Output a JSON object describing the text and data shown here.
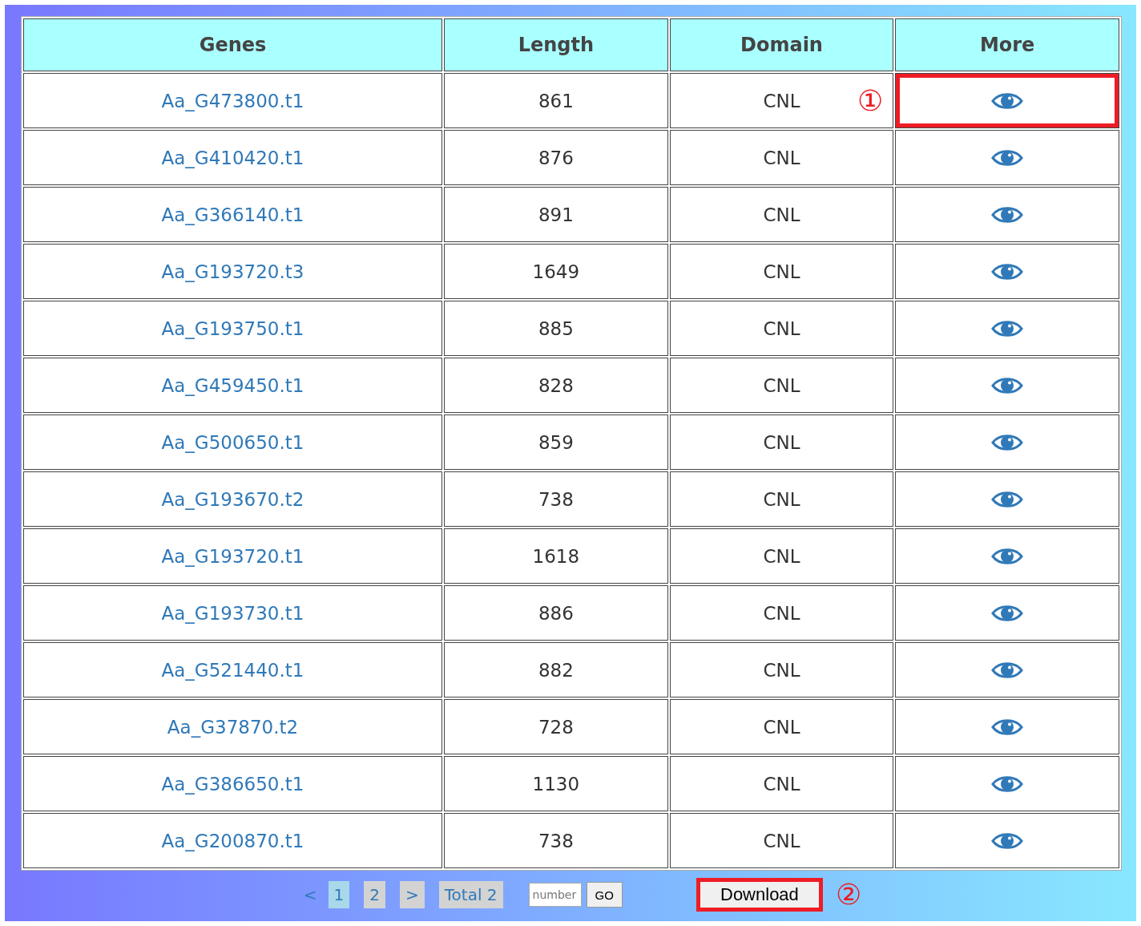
{
  "table": {
    "columns": [
      "Genes",
      "Length",
      "Domain",
      "More"
    ],
    "rows": [
      {
        "gene": "Aa_G473800.t1",
        "length": "861",
        "domain": "CNL",
        "highlighted": true,
        "callout": "①"
      },
      {
        "gene": "Aa_G410420.t1",
        "length": "876",
        "domain": "CNL",
        "highlighted": false
      },
      {
        "gene": "Aa_G366140.t1",
        "length": "891",
        "domain": "CNL",
        "highlighted": false
      },
      {
        "gene": "Aa_G193720.t3",
        "length": "1649",
        "domain": "CNL",
        "highlighted": false
      },
      {
        "gene": "Aa_G193750.t1",
        "length": "885",
        "domain": "CNL",
        "highlighted": false
      },
      {
        "gene": "Aa_G459450.t1",
        "length": "828",
        "domain": "CNL",
        "highlighted": false
      },
      {
        "gene": "Aa_G500650.t1",
        "length": "859",
        "domain": "CNL",
        "highlighted": false
      },
      {
        "gene": "Aa_G193670.t2",
        "length": "738",
        "domain": "CNL",
        "highlighted": false
      },
      {
        "gene": "Aa_G193720.t1",
        "length": "1618",
        "domain": "CNL",
        "highlighted": false
      },
      {
        "gene": "Aa_G193730.t1",
        "length": "886",
        "domain": "CNL",
        "highlighted": false
      },
      {
        "gene": "Aa_G521440.t1",
        "length": "882",
        "domain": "CNL",
        "highlighted": false
      },
      {
        "gene": "Aa_G37870.t2",
        "length": "728",
        "domain": "CNL",
        "highlighted": false
      },
      {
        "gene": "Aa_G386650.t1",
        "length": "1130",
        "domain": "CNL",
        "highlighted": false
      },
      {
        "gene": "Aa_G200870.t1",
        "length": "738",
        "domain": "CNL",
        "highlighted": false
      }
    ]
  },
  "pagination": {
    "prev": "<",
    "pages": [
      {
        "label": "1",
        "selected": true
      },
      {
        "label": "2",
        "selected": false
      }
    ],
    "next": ">",
    "total": "Total 2",
    "page_input": {
      "placeholder": "number"
    },
    "go": "GO"
  },
  "download": {
    "label": "Download",
    "highlighted": true,
    "callout": "②"
  }
}
